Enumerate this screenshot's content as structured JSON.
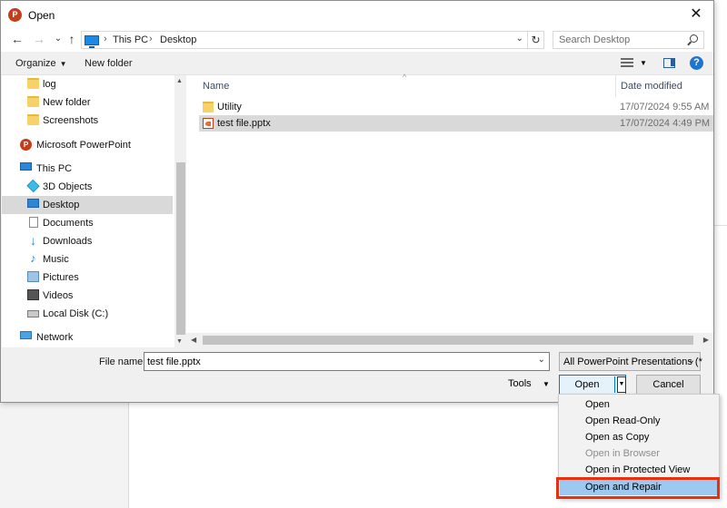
{
  "window": {
    "title": "Open",
    "app_icon": "powerpoint-icon",
    "close_glyph": "✕"
  },
  "nav": {
    "back_glyph": "←",
    "forward_glyph": "→",
    "recent_glyph": "⌄",
    "up_glyph": "↑",
    "refresh_glyph": "↻",
    "breadcrumb": [
      "This PC",
      "Desktop"
    ],
    "breadcrumb_sep": "›",
    "search_placeholder": "Search Desktop"
  },
  "toolbar": {
    "organize_label": "Organize",
    "new_folder_label": "New folder",
    "help_glyph": "?"
  },
  "tree": {
    "items": [
      {
        "label": "log",
        "icon": "folder-icon"
      },
      {
        "label": "New folder",
        "icon": "folder-icon"
      },
      {
        "label": "Screenshots",
        "icon": "folder-icon"
      },
      {
        "label": "Microsoft PowerPoint",
        "icon": "powerpoint-icon"
      },
      {
        "label": "This PC",
        "icon": "computer-icon"
      },
      {
        "label": "3D Objects",
        "icon": "3d-objects-icon"
      },
      {
        "label": "Desktop",
        "icon": "desktop-icon",
        "selected": true
      },
      {
        "label": "Documents",
        "icon": "documents-icon"
      },
      {
        "label": "Downloads",
        "icon": "downloads-icon"
      },
      {
        "label": "Music",
        "icon": "music-icon"
      },
      {
        "label": "Pictures",
        "icon": "pictures-icon"
      },
      {
        "label": "Videos",
        "icon": "videos-icon"
      },
      {
        "label": "Local Disk (C:)",
        "icon": "disk-icon"
      },
      {
        "label": "Network",
        "icon": "network-icon"
      }
    ]
  },
  "files": {
    "columns": {
      "name": "Name",
      "date": "Date modified"
    },
    "rows": [
      {
        "name": "Utility",
        "date": "17/07/2024 9:55 AM",
        "icon": "folder-icon"
      },
      {
        "name": "test file.pptx",
        "date": "17/07/2024 4:49 PM",
        "icon": "pptx-file-icon",
        "selected": true
      }
    ]
  },
  "bottom": {
    "file_name_label": "File name:",
    "file_name_value": "test file.pptx",
    "file_type": "All PowerPoint Presentations (*",
    "tools_label": "Tools",
    "open_label": "Open",
    "cancel_label": "Cancel"
  },
  "open_menu": {
    "items": [
      {
        "label": "Open",
        "enabled": true
      },
      {
        "label": "Open Read-Only",
        "enabled": true
      },
      {
        "label": "Open as Copy",
        "enabled": true
      },
      {
        "label": "Open in Browser",
        "enabled": false
      },
      {
        "label": "Open in Protected View",
        "enabled": true
      },
      {
        "label": "Open and Repair",
        "enabled": true,
        "highlighted": true
      }
    ]
  },
  "colors": {
    "accent": "#0078d7",
    "highlight": "#9dc8ef",
    "callout": "#e53012",
    "ppt": "#c43e1c"
  }
}
